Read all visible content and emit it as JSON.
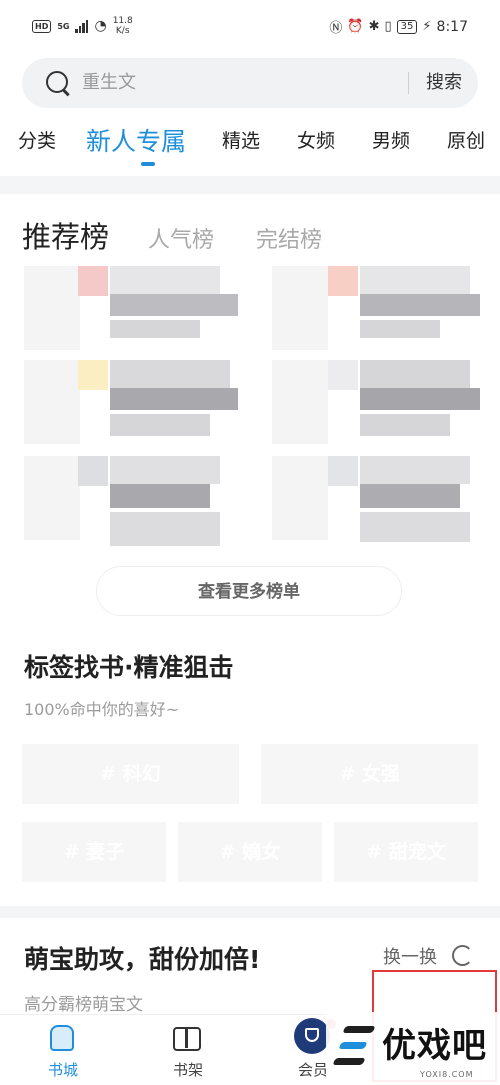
{
  "status_bar": {
    "hd": "HD",
    "network": "5G",
    "speed_value": "11.8",
    "speed_unit": "K/s",
    "battery": "35",
    "time": "8:17"
  },
  "search": {
    "placeholder": "重生文",
    "button": "搜索"
  },
  "tabs": [
    "分类",
    "新人专属",
    "精选",
    "女频",
    "男频",
    "原创"
  ],
  "active_tab": "新人专属",
  "ranking": {
    "tabs": [
      "推荐榜",
      "人气榜",
      "完结榜"
    ],
    "active": "推荐榜",
    "more_button": "查看更多榜单"
  },
  "tag_section": {
    "title": "标签找书·精准狙击",
    "subtitle": "100%命中你的喜好~",
    "tags": [
      "# 科幻",
      "# 女强",
      "# 妻子",
      "# 嫡女",
      "# 甜宠文"
    ]
  },
  "promo": {
    "title": "萌宝助攻，甜份加倍!",
    "subtitle": "高分霸榜萌宝文",
    "refresh": "换一换"
  },
  "bottom_nav": {
    "items": [
      "书城",
      "书架",
      "会员",
      ""
    ],
    "active": "书城"
  },
  "watermark": {
    "text": "优戏吧",
    "url": "YOXI8.COM"
  },
  "colors": {
    "accent": "#1f8fdc",
    "highlight_box": "#e23a3a",
    "vip": "#1e3a78"
  }
}
